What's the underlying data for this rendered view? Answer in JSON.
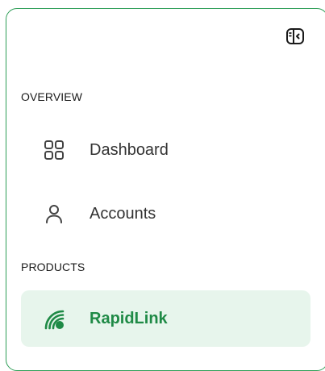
{
  "sidebar": {
    "collapse_icon": "sidebar-collapse-icon",
    "sections": [
      {
        "label": "OVERVIEW",
        "items": [
          {
            "label": "Dashboard",
            "icon": "grid-icon",
            "active": false
          },
          {
            "label": "Accounts",
            "icon": "user-icon",
            "active": false
          }
        ]
      },
      {
        "label": "PRODUCTS",
        "items": [
          {
            "label": "RapidLink",
            "icon": "signal-icon",
            "active": true
          }
        ]
      }
    ]
  },
  "colors": {
    "accent": "#1f8a46",
    "border": "#2e9e57",
    "active_bg": "#e7f5ec",
    "text": "#333333"
  }
}
